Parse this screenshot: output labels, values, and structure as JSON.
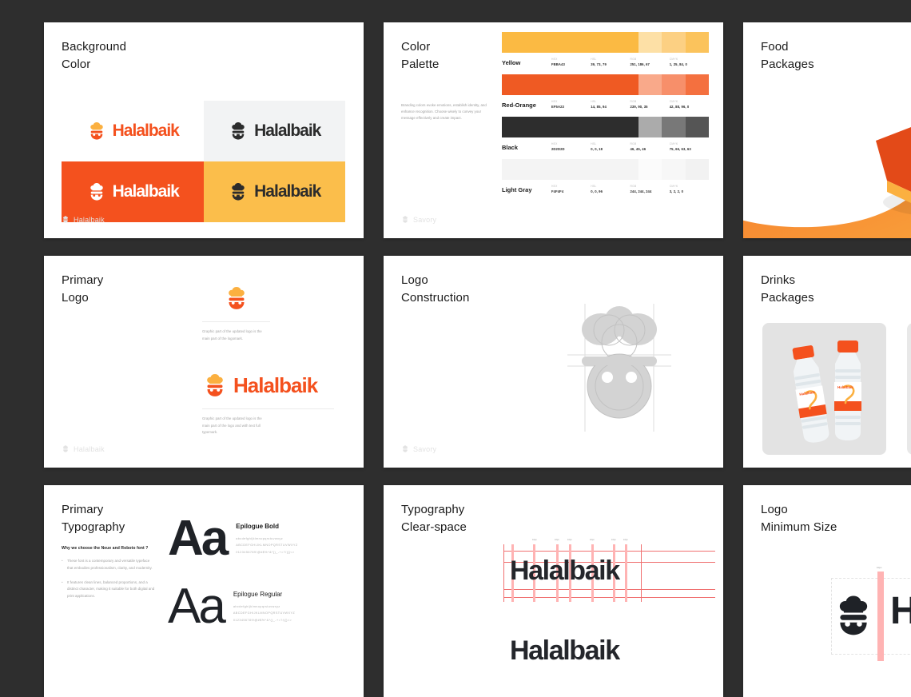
{
  "board": {
    "background_color": "#2e2e2e",
    "brand_name": "Halalbaik",
    "accent_orange": "#F4511E",
    "accent_yellow": "#FBB040",
    "accent_black": "#2C2C2C",
    "accent_light_gray": "#F4F4F4"
  },
  "cards": {
    "background_color": {
      "title": "Background\nColor",
      "footer_label": "Halalbaik",
      "swatches": [
        {
          "name": "white",
          "bg": "#FFFFFF",
          "mark_hat": "#FBB040",
          "mark_bowl": "#F4511E",
          "word_color": "#F4511E"
        },
        {
          "name": "light-gray",
          "bg": "#F2F3F4",
          "mark_hat": "#2C2C2C",
          "mark_bowl": "#2C2C2C",
          "word_color": "#2C2C2C"
        },
        {
          "name": "red-orange",
          "bg": "#F4511E",
          "mark_hat": "#FFFFFF",
          "mark_bowl": "#FFFFFF",
          "word_color": "#FFFFFF"
        },
        {
          "name": "yellow",
          "bg": "#FBBE4B",
          "mark_hat": "#2C2C2C",
          "mark_bowl": "#2C2C2C",
          "word_color": "#2C2C2C"
        }
      ]
    },
    "color_palette": {
      "title": "Color\nPalette",
      "description": "Branding colors evoke emotions, establish identity, and enhance recognition. Choose wisely to convey your message effectively and create impact.",
      "footer_label": "Savory",
      "keys": [
        "HEX",
        "HSL",
        "RGB",
        "CMYK"
      ],
      "colors": [
        {
          "name": "Yellow",
          "hex_label": "FBBA43",
          "hsl": "39, 73, 79",
          "rgb": "251, 186, 67",
          "cmyk": "1, 25, 84, 0",
          "base": "#FBBA43",
          "tints": [
            "#FDE0A6",
            "#FCD083",
            "#FBC35C"
          ]
        },
        {
          "name": "Red-Orange",
          "hex_label": "EF5A23",
          "hsl": "14, 85, 94",
          "rgb": "239, 90, 35",
          "cmyk": "42, 88, 96, 0",
          "base": "#EF5A23",
          "tints": [
            "#F9A98A",
            "#F78F6A",
            "#F4703F"
          ]
        },
        {
          "name": "Black",
          "hex_label": "2D2D2D",
          "hsl": "0, 0, 18",
          "rgb": "46, 45, 46",
          "cmyk": "75, 66, 63, 63",
          "base": "#2D2D2D",
          "tints": [
            "#ABABAB",
            "#787878",
            "#555555"
          ]
        },
        {
          "name": "Light Gray",
          "hex_label": "F4F4F4",
          "hsl": "0, 0, 96",
          "rgb": "244, 244, 244",
          "cmyk": "3, 2, 2, 0",
          "base": "#F4F4F4",
          "tints": [
            "#FBFBFB",
            "#F7F7F7",
            "#F2F2F2"
          ]
        }
      ]
    },
    "food_packages": {
      "title": "Food\nPackages",
      "image_alt": "halalbaik-burger-box-packaging"
    },
    "primary_logo": {
      "title": "Primary\nLogo",
      "footer_label": "Halalbaik",
      "mark_caption": "Graphic part of the updated logo is the main part of the logomark.",
      "lockup_caption": "Graphic part of the updated logo is the main part of the logo and with text full typemark."
    },
    "logo_construction": {
      "title": "Logo\nConstruction",
      "footer_label": "Savory",
      "image_alt": "logo-geometric-construction-grid"
    },
    "drinks_packages": {
      "title": "Drinks\nPackages",
      "image_alt": "halalbaik-water-bottles-and-coffee-cup"
    },
    "primary_typography": {
      "title": "Primary\nTypography",
      "why_heading": "Why we choose the Neue and Roboto font ?",
      "why_points": [
        "These font is a contemporary and versatile typeface that embodies professionalism, clarity, and modernity.",
        "It features clean lines, balanced proportions, and a distinct character, making it suitable for both digital and print applications."
      ],
      "specimens": [
        {
          "sample": "Aa",
          "name": "Epilogue Bold",
          "weight": "bold",
          "glyphs": "abcdefghijklmnopqrstuvwxyz\nABCDEFGHIJKLMNOPQRSTUVWXYZ\n0123456789!@#$%^&*()_-+=?/|{}<>"
        },
        {
          "sample": "Aa",
          "name": "Epilogue Regular",
          "weight": "regular",
          "glyphs": "abcdefghijklmnopqrstuvwxyz\nABCDEFGHIJKLMNOPQRSTUVWXYZ\n0123456789!@#$%^&*()_-+=?/|{}<>"
        }
      ]
    },
    "typography_clearspace": {
      "title": "Typography\nClear-space",
      "word": "Halalbaik",
      "word_secondary": "Halalbaik",
      "tick_labels": [
        "10px",
        "10px",
        "10px",
        "10px",
        "10px",
        "10px",
        "10px"
      ]
    },
    "logo_minimum_size": {
      "title": "Logo\nMinimum Size",
      "word_fragment": "Ha",
      "gap_label": "10px"
    }
  }
}
